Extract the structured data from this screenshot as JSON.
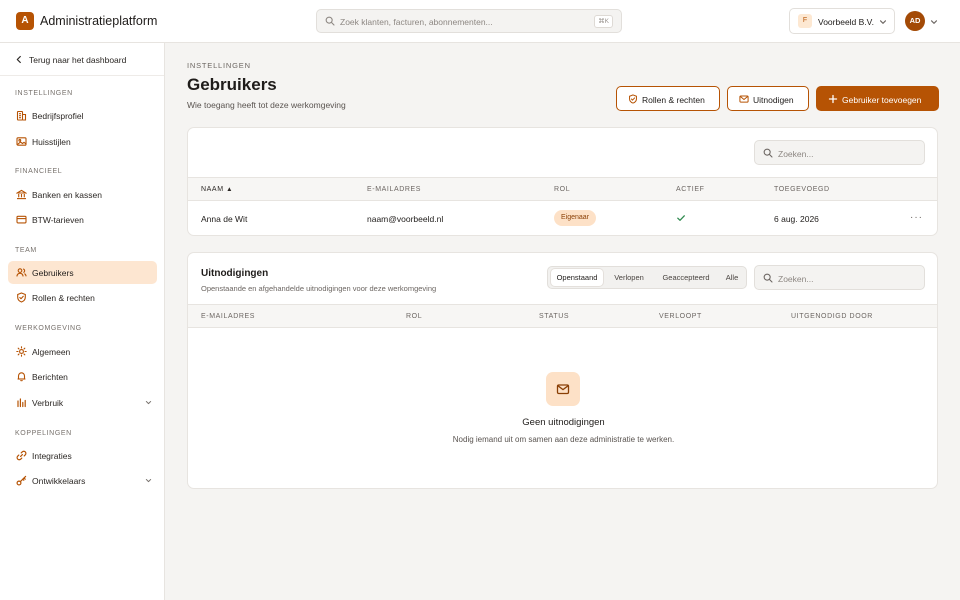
{
  "app": {
    "logo_letter": "A",
    "name": "Administratieplatform"
  },
  "topbar": {
    "search_placeholder": "Zoek klanten, facturen, abonnementen...",
    "search_shortcut": "⌘K",
    "org_badge": "F",
    "org_name": "Voorbeeld B.V.",
    "avatar_initials": "AD"
  },
  "sidebar": {
    "back_label": "Terug naar het dashboard",
    "sections": [
      {
        "label": "INSTELLINGEN",
        "items": [
          {
            "label": "Bedrijfsprofiel",
            "icon": "building-icon"
          },
          {
            "label": "Huisstijlen",
            "icon": "image-icon"
          }
        ]
      },
      {
        "label": "FINANCIEEL",
        "items": [
          {
            "label": "Banken en kassen",
            "icon": "bank-icon"
          },
          {
            "label": "BTW-tarieven",
            "icon": "card-icon"
          }
        ]
      },
      {
        "label": "TEAM",
        "items": [
          {
            "label": "Gebruikers",
            "icon": "users-icon",
            "active": true
          },
          {
            "label": "Rollen & rechten",
            "icon": "shield-icon"
          }
        ]
      },
      {
        "label": "WERKOMGEVING",
        "items": [
          {
            "label": "Algemeen",
            "icon": "sun-icon"
          },
          {
            "label": "Berichten",
            "icon": "bell-icon"
          },
          {
            "label": "Verbruik",
            "icon": "bar-chart-icon",
            "expandable": true
          }
        ]
      },
      {
        "label": "KOPPELINGEN",
        "items": [
          {
            "label": "Integraties",
            "icon": "link-icon"
          },
          {
            "label": "Ontwikkelaars",
            "icon": "key-icon",
            "expandable": true
          }
        ]
      }
    ]
  },
  "header": {
    "eyebrow": "INSTELLINGEN",
    "title": "Gebruikers",
    "subtitle": "Wie toegang heeft tot deze werkomgeving",
    "btn_roles": "Rollen & rechten",
    "btn_invite": "Uitnodigen",
    "btn_add": "Gebruiker toevoegen"
  },
  "users": {
    "search_placeholder": "Zoeken...",
    "columns": {
      "name": "NAAM",
      "email": "E-MAILADRES",
      "role": "ROL",
      "active": "ACTIEF",
      "added": "TOEGEVOEGD"
    },
    "sort_indicator": "▲",
    "rows": [
      {
        "name": "Anna de Wit",
        "email": "naam@voorbeeld.nl",
        "role": "Eigenaar",
        "active": true,
        "added": "6 aug. 2026"
      }
    ],
    "more_label": "···"
  },
  "invitations": {
    "title": "Uitnodigingen",
    "subtitle": "Openstaande en afgehandelde uitnodigingen voor deze werkomgeving",
    "filters": [
      "Openstaand",
      "Verlopen",
      "Geaccepteerd",
      "Alle"
    ],
    "active_filter": "Openstaand",
    "search_placeholder": "Zoeken...",
    "columns": {
      "email": "E-MAILADRES",
      "role": "ROL",
      "status": "STATUS",
      "expires": "VERLOOPT",
      "invited_by": "UITGENODIGD DOOR"
    },
    "empty_title": "Geen uitnodigingen",
    "empty_text": "Nodig iemand uit om samen aan deze administratie te werken."
  },
  "colors": {
    "accent": "#b65304",
    "accent_soft": "#fde6d1",
    "success": "#2f8a4f"
  }
}
